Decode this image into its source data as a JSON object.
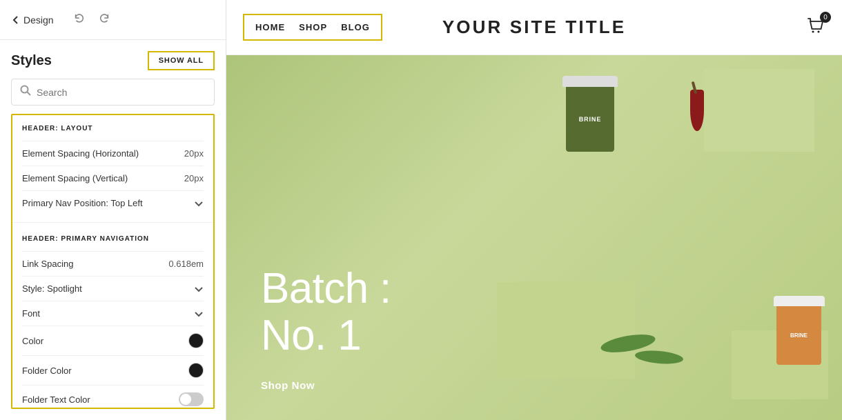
{
  "topbar": {
    "back_label": "Design",
    "undo_title": "Undo",
    "redo_title": "Redo"
  },
  "sidebar": {
    "title": "Styles",
    "show_all_label": "SHOW ALL",
    "search_placeholder": "Search"
  },
  "sections": {
    "header_layout": {
      "title": "HEADER: LAYOUT",
      "rows": [
        {
          "label": "Element Spacing (Horizontal)",
          "value": "20px",
          "type": "value"
        },
        {
          "label": "Element Spacing (Vertical)",
          "value": "20px",
          "type": "value"
        },
        {
          "label": "Primary Nav Position: Top Left",
          "value": "",
          "type": "dropdown"
        }
      ]
    },
    "header_nav": {
      "title": "HEADER: PRIMARY NAVIGATION",
      "rows": [
        {
          "label": "Link Spacing",
          "value": "0.618em",
          "type": "value"
        },
        {
          "label": "Style: Spotlight",
          "value": "",
          "type": "dropdown"
        },
        {
          "label": "Font",
          "value": "",
          "type": "dropdown"
        },
        {
          "label": "Color",
          "value": "",
          "type": "color_black"
        },
        {
          "label": "Folder Color",
          "value": "",
          "type": "color_black"
        },
        {
          "label": "Folder Text Color",
          "value": "",
          "type": "toggle"
        }
      ]
    }
  },
  "site_header": {
    "nav_items": [
      "HOME",
      "SHOP",
      "BLOG"
    ],
    "site_title": "YOUR SITE TITLE",
    "cart_count": "0"
  },
  "hero": {
    "title_line1": "Batch :",
    "title_line2": "No. 1",
    "cta_label": "Shop Now",
    "jar_label_green": "BRINE",
    "jar_label_amber": "BRINE"
  }
}
